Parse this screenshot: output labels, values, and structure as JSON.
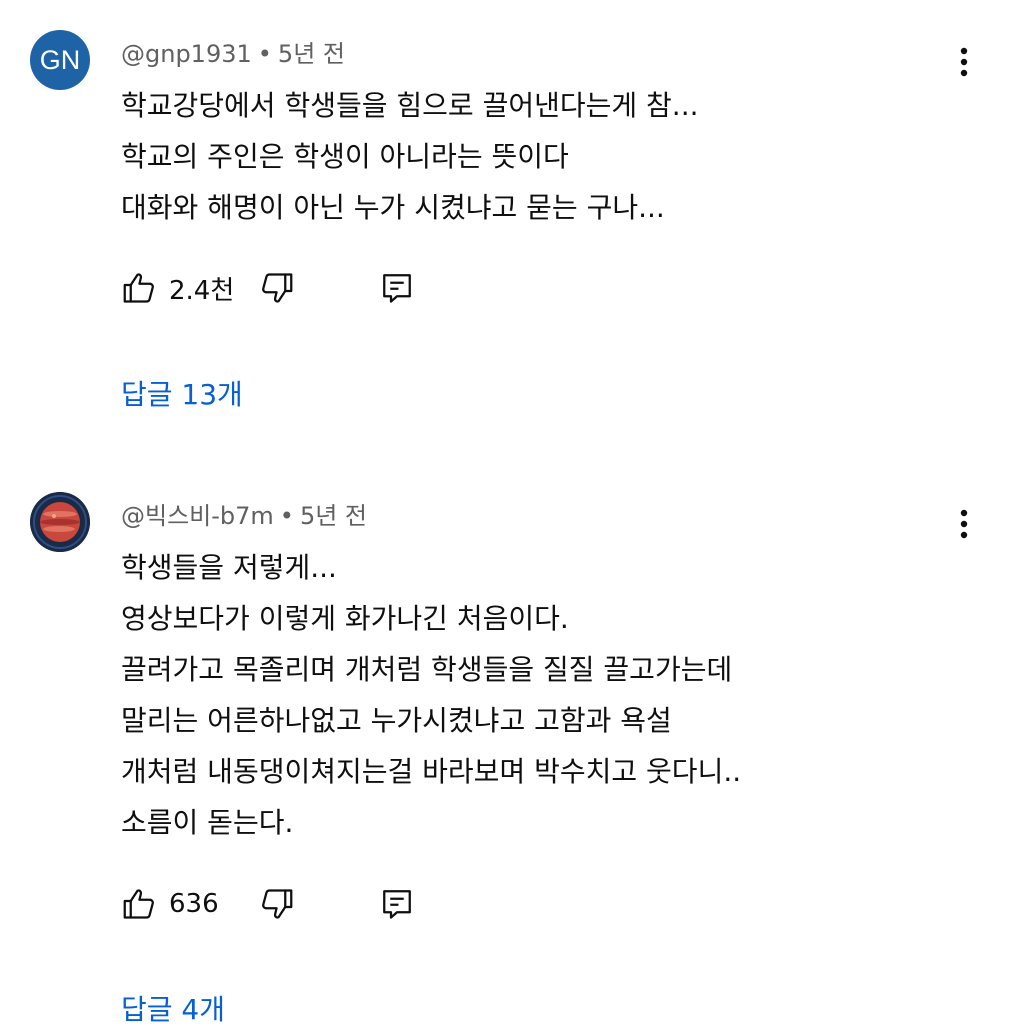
{
  "comments": [
    {
      "author": "@gnp1931",
      "time": "5년 전",
      "avatar": {
        "type": "initials",
        "text": "GN",
        "color": "#1e63a6"
      },
      "lines": [
        "학교강당에서 학생들을 힘으로 끌어낸다는게 참...",
        "학교의 주인은 학생이 아니라는 뜻이다",
        "대화와 해명이 아닌 누가 시켰냐고 묻는 구나..."
      ],
      "likes": "2.4천",
      "replies_label": "답글 13개"
    },
    {
      "author": "@빅스비-b7m",
      "time": "5년 전",
      "avatar": {
        "type": "image",
        "icon": "planet-avatar-icon"
      },
      "lines": [
        "학생들을 저렇게...",
        "영상보다가 이렇게 화가나긴 처음이다.",
        "끌려가고 목졸리며 개처럼 학생들을 질질 끌고가는데",
        "말리는 어른하나없고 누가시켰냐고 고함과 욕설",
        "개처럼 내동댕이쳐지는걸 바라보며 박수치고 웃다니..",
        "소름이 돋는다."
      ],
      "likes": "636",
      "replies_label": "답글 4개"
    }
  ],
  "meta_separator": "•",
  "icons": {
    "like": "thumbs-up-icon",
    "dislike": "thumbs-down-icon",
    "reply": "reply-comment-icon",
    "menu": "more-vertical-icon"
  },
  "colors": {
    "link": "#065fd4",
    "meta": "#606060",
    "text": "#0f0f0f"
  }
}
